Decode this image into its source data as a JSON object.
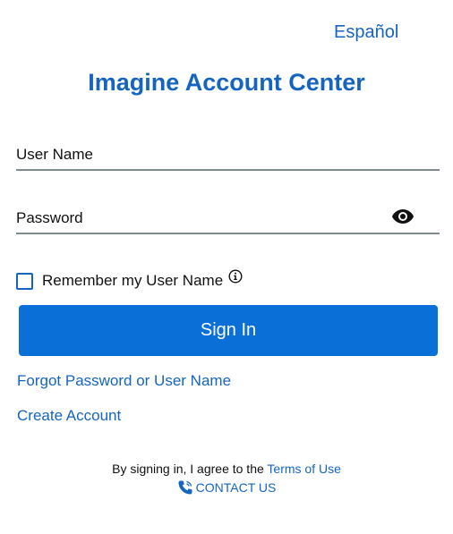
{
  "header": {
    "language_link": "Español",
    "title": "Imagine Account Center"
  },
  "form": {
    "username_label": "User Name",
    "password_label": "Password",
    "password_toggle_icon": "eye-icon",
    "remember_label": "Remember my User Name",
    "remember_checked": false,
    "info_icon": "info-icon",
    "signin_label": "Sign In"
  },
  "links": {
    "forgot": "Forgot Password or User Name",
    "create": "Create Account"
  },
  "footer": {
    "agree_text": "By signing in, I agree to the",
    "terms_link": "Terms of Use",
    "contact_icon": "phone-icon",
    "contact_label": "CONTACT US"
  },
  "colors": {
    "accent": "#1565c0",
    "button": "#0b6fd8",
    "field_border": "#7f8c8d"
  }
}
